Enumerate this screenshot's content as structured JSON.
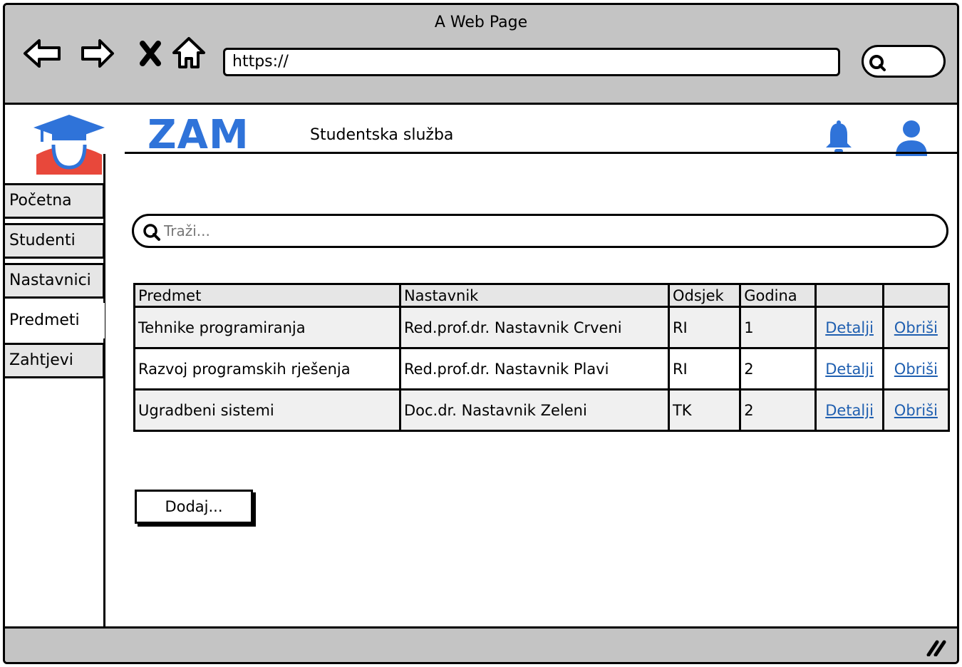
{
  "browser": {
    "window_title": "A Web Page",
    "url": "https://"
  },
  "app": {
    "brand": "ZAM",
    "subtitle": "Studentska služba",
    "brand_color": "#2f73d9",
    "icons": [
      "graduation-cap-logo-icon",
      "bell-icon",
      "user-icon",
      "search-icon"
    ]
  },
  "sidebar": {
    "items": [
      {
        "label": "Početna",
        "active": false
      },
      {
        "label": "Studenti",
        "active": false
      },
      {
        "label": "Nastavnici",
        "active": false
      },
      {
        "label": "Predmeti",
        "active": true
      },
      {
        "label": "Zahtjevi",
        "active": false
      }
    ]
  },
  "search": {
    "placeholder": "Traži..."
  },
  "table": {
    "headers": [
      "Predmet",
      "Nastavnik",
      "Odsjek",
      "Godina",
      "",
      ""
    ],
    "rows": [
      {
        "predmet": "Tehnike programiranja",
        "nastavnik": "Red.prof.dr. Nastavnik Crveni",
        "odsjek": "RI",
        "godina": "1",
        "details": "Detalji",
        "delete": "Obriši"
      },
      {
        "predmet": "Razvoj programskih rješenja",
        "nastavnik": "Red.prof.dr. Nastavnik Plavi",
        "odsjek": "RI",
        "godina": "2",
        "details": "Detalji",
        "delete": "Obriši"
      },
      {
        "predmet": "Ugradbeni sistemi",
        "nastavnik": "Doc.dr. Nastavnik Zeleni",
        "odsjek": "TK",
        "godina": "2",
        "details": "Detalji",
        "delete": "Obriši"
      }
    ],
    "link_color": "#1f5fb0"
  },
  "actions": {
    "add_label": "Dodaj..."
  }
}
